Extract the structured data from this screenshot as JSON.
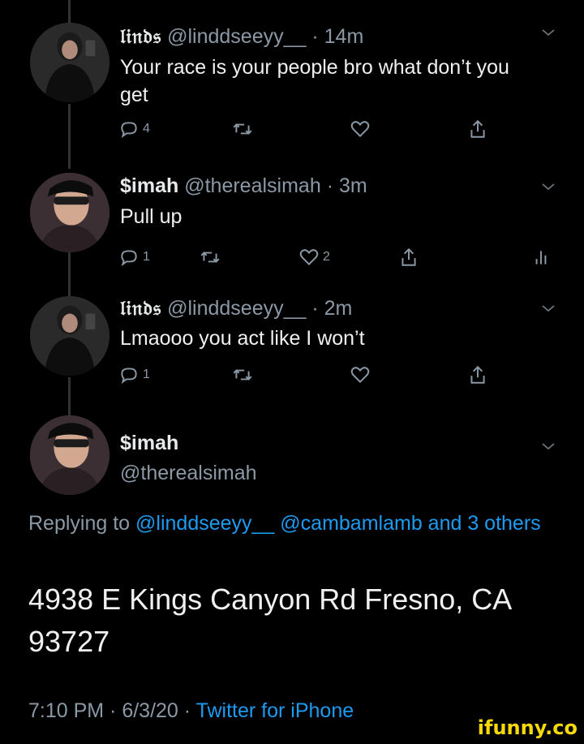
{
  "tweets": [
    {
      "name": "𝔩𝔦𝔫𝔡𝔰",
      "handle": "@linddseeyy__",
      "time": "14m",
      "text": "Your race is your people bro what don’t you get",
      "replies": "4",
      "retweets": "",
      "likes": ""
    },
    {
      "name": "$imah",
      "handle": "@therealsimah",
      "time": "3m",
      "text": "Pull up",
      "replies": "1",
      "retweets": "",
      "likes": "2"
    },
    {
      "name": "𝔩𝔦𝔫𝔡𝔰",
      "handle": "@linddseeyy__",
      "time": "2m",
      "text": "Lmaooo you act like I won’t",
      "replies": "1",
      "retweets": "",
      "likes": ""
    }
  ],
  "main_tweet": {
    "name": "$imah",
    "handle": "@therealsimah",
    "replying_prefix": "Replying to",
    "replying_users": "@linddseeyy__ @cambamlamb and 3 others",
    "text": "4938 E Kings Canyon Rd Fresno, CA 93727",
    "timestamp": "7:10 PM · 6/3/20 · ",
    "client": "Twitter for iPhone"
  },
  "separator": "·",
  "watermark": "ifunny.co",
  "icons": {
    "reply": "reply-icon",
    "retweet": "retweet-icon",
    "like": "heart-icon",
    "share": "share-icon",
    "analytics": "analytics-icon",
    "more": "chevron-down-icon"
  },
  "colors": {
    "background": "#000000",
    "link": "#1d9bf0",
    "muted": "#8b98a5"
  }
}
